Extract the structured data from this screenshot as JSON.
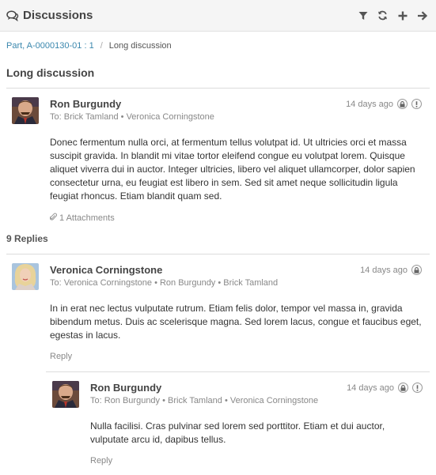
{
  "header": {
    "title": "Discussions",
    "actions": [
      "filter-icon",
      "refresh-icon",
      "add-icon",
      "arrow-right-icon"
    ]
  },
  "breadcrumb": {
    "parent": "Part, A-0000130-01 : 1",
    "separator": "/",
    "current": "Long discussion"
  },
  "page_title": "Long discussion",
  "main_post": {
    "author": "Ron Burgundy",
    "to": "To: Brick Tamland • Veronica Corningstone",
    "time": "14 days ago",
    "body": "Donec fermentum nulla orci, at fermentum tellus volutpat id. Ut ultricies orci et massa suscipit gravida. In blandit mi vitae tortor eleifend congue eu volutpat lorem. Quisque aliquet viverra dui in auctor. Integer ultricies, libero vel aliquet ullamcorper, dolor sapien consectetur urna, eu feugiat est libero in sem. Sed sit amet neque sollicitudin ligula feugiat rhoncus. Etiam blandit quam sed.",
    "attachments": "1 Attachments"
  },
  "replies_label": "9 Replies",
  "reply1": {
    "author": "Veronica Corningstone",
    "to": "To: Veronica Corningstone • Ron Burgundy • Brick Tamland",
    "time": "14 days ago",
    "body": "In in erat nec lectus vulputate rutrum. Etiam felis dolor, tempor vel massa in, gravida bibendum metus. Duis ac scelerisque magna. Sed lorem lacus, congue et faucibus eget, egestas in lacus.",
    "reply": "Reply"
  },
  "reply2": {
    "author": "Ron Burgundy",
    "to": "To: Ron Burgundy • Brick Tamland • Veronica Corningstone",
    "time": "14 days ago",
    "body": "Nulla facilisi. Cras pulvinar sed lorem sed porttitor. Etiam et dui auctor, vulputate arcu id, dapibus tellus.",
    "reply": "Reply"
  },
  "colors": {
    "link": "#3a87ad",
    "header_bg": "#f5f5f5",
    "muted": "#888888"
  }
}
